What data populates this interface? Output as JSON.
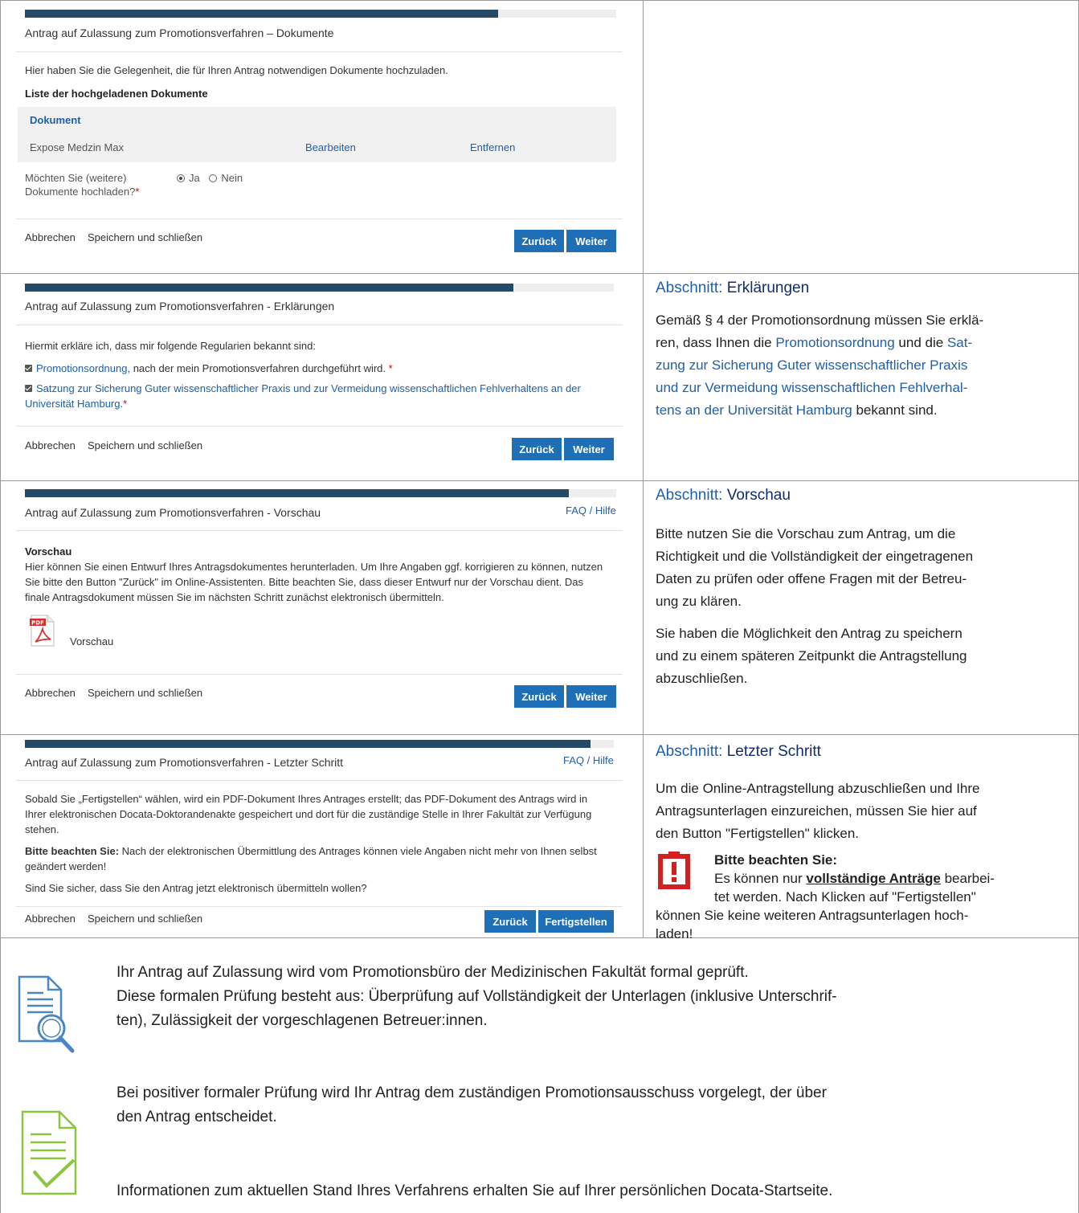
{
  "common": {
    "cancel": "Abbrechen",
    "save_close": "Speichern und schließen",
    "back": "Zurück",
    "next": "Weiter",
    "faq": "FAQ / Hilfe"
  },
  "p1": {
    "title": "Antrag auf Zulassung zum Promotionsverfahren – Dokumente",
    "progress": 0.8,
    "intro": "Hier haben Sie die Gelegenheit, die für Ihren Antrag notwendigen Dokumente hochzuladen.",
    "list_heading": "Liste der hochgeladenen Dokumente",
    "table_header": "Dokument",
    "row_name": "Expose Medzin Max",
    "row_edit": "Bearbeiten",
    "row_remove": "Entfernen",
    "question_line1": "Möchten Sie (weitere)",
    "question_line2": "Dokumente hochladen?",
    "option_yes": "Ja",
    "option_no": "Nein"
  },
  "p2": {
    "title": "Antrag auf Zulassung zum Promotionsverfahren - Erklärungen",
    "progress": 0.83,
    "intro": "Hiermit erkläre ich, dass mir folgende Regularien bekannt sind:",
    "item1_link": "Promotionsordnung,",
    "item1_rest": " nach der mein Promotionsverfahren durchgeführt wird.",
    "item2_line1": "Satzung zur Sicherung Guter wissenschaftlicher Praxis und zur Vermeidung wissenschaftlichen Fehlverhaltens an der",
    "item2_line2": "Universität Hamburg."
  },
  "p3": {
    "title": "Antrag auf Zulassung zum Promotionsverfahren - Vorschau",
    "progress": 0.92,
    "heading": "Vorschau",
    "text1": "Hier können Sie einen Entwurf Ihres Antragsdokumentes herunterladen. Um Ihre Angaben ggf. korrigieren zu können, nutzen",
    "text2": "Sie bitte den Button \"Zurück\" im Online-Assistenten. Bitte beachten Sie, dass dieser Entwurf nur der Vorschau dient. Das",
    "text3": "finale Antragsdokument müssen Sie im nächsten Schritt zunächst elektronisch übermitteln.",
    "pdf_badge": "PDF",
    "pdf_link": "Vorschau"
  },
  "p4": {
    "title": "Antrag auf Zulassung zum Promotionsverfahren - Letzter Schritt",
    "progress": 0.96,
    "text1": "Sobald Sie „Fertigstellen“ wählen, wird ein PDF-Dokument Ihres Antrages erstellt; das PDF-Dokument des Antrags wird in",
    "text2": "Ihrer elektronischen Docata-Doktorandenakte gespeichert und dort für die zuständige Stelle in Ihrer Fakultät zur Verfügung",
    "text3": "stehen.",
    "note_bold": "Bitte beachten Sie:",
    "note_rest": " Nach der elektronischen Übermittlung des Antrages können viele Angaben nicht mehr von Ihnen selbst",
    "note_line2": "geändert werden!",
    "question": "Sind Sie sicher, dass Sie den Antrag jetzt elektronisch übermitteln wollen?",
    "finish": "Fertigstellen"
  },
  "side": {
    "label": "Abschnitt: ",
    "s2_name": "Erklärungen",
    "s2_l1_a": "Gemäß § 4 der Promotionsordnung müssen Sie erklä-",
    "s2_l2_a": "ren, dass Ihnen die ",
    "s2_l2_link": "Promotionsordnung",
    "s2_l2_b": " und die ",
    "s2_l2_link2": "Sat-",
    "s2_l3": "zung zur Sicherung Guter wissenschaftlicher Praxis",
    "s2_l4": "und zur Vermeidung wissenschaftlichen Fehlverhal-",
    "s2_l5_link": "tens an der Universität Hamburg",
    "s2_l5_b": " bekannt sind.",
    "s3_name": "Vorschau",
    "s3_l1": "Bitte nutzen Sie die Vorschau zum Antrag, um die",
    "s3_l2": "Richtigkeit und die Vollständigkeit der eingetragenen",
    "s3_l3": "Daten zu prüfen oder offene Fragen mit der Betreu-",
    "s3_l4": "ung zu klären.",
    "s3_l5": "Sie haben die Möglichkeit den Antrag zu speichern",
    "s3_l6": "und zu einem späteren Zeitpunkt die Antragstellung",
    "s3_l7": "abzuschließen.",
    "s4_name": "Letzter Schritt",
    "s4_l1": "Um die Online-Antragstellung abzuschließen und Ihre",
    "s4_l2": "Antragsunterlagen einzureichen, müssen Sie hier auf",
    "s4_l3": "den Button \"Fertigstellen\" klicken.",
    "s4_warn_head": "Bitte beachten Sie:",
    "s4_warn_l1_a": "Es können nur ",
    "s4_warn_l1_b": "vollständige Anträge",
    "s4_warn_l1_c": " bearbei-",
    "s4_warn_l2": "tet werden. Nach Klicken auf \"Fertigstellen\"",
    "s4_warn_l3": "können Sie keine weiteren Antragsunterlagen hoch-",
    "s4_warn_l4": "laden!"
  },
  "bottom": {
    "l1": "Ihr Antrag auf Zulassung wird vom Promotionsbüro der Medizinischen Fakultät formal geprüft.",
    "l2": "Diese formalen Prüfung besteht aus: Überprüfung auf Vollständigkeit der Unterlagen (inklusive Unterschrif-",
    "l3": "ten), Zulässigkeit der vorgeschlagenen Betreuer:innen.",
    "l4": "Bei positiver formaler Prüfung wird Ihr Antrag dem zuständigen Promotionsausschuss vorgelegt, der über",
    "l5": "den Antrag entscheidet.",
    "l6": "Informationen zum aktuellen Stand Ihres Verfahrens erhalten Sie auf Ihrer persönlichen Docata-Startseite."
  },
  "colors": {
    "progress": "#264a66",
    "button": "#1f6fb6",
    "link": "#1f5fa8",
    "warning": "#d42020",
    "icon_blue": "#4a87c6",
    "icon_green": "#8cc63f"
  }
}
